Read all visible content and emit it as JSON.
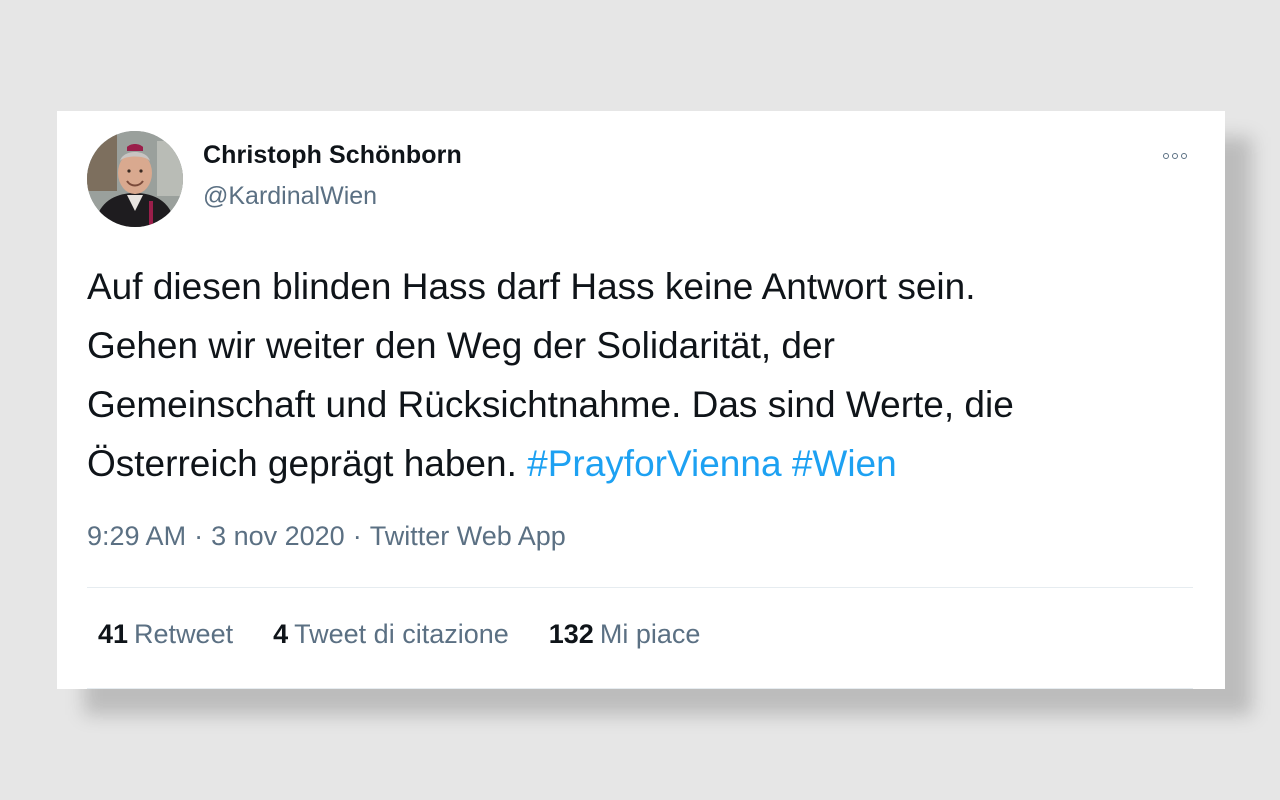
{
  "tweet": {
    "author_name": "Christoph Schönborn",
    "author_handle": "@KardinalWien",
    "text_lines": [
      "Auf diesen blinden Hass darf Hass keine Antwort sein.",
      "Gehen wir weiter den Weg der Solidarität, der",
      "Gemeinschaft und Rücksichtnahme. Das sind Werte, die",
      "Österreich geprägt haben. "
    ],
    "hashtags": [
      "#PrayforVienna",
      "#Wien"
    ],
    "time": "9:29 AM",
    "date": "3 nov 2020",
    "source": "Twitter Web App",
    "separator": "·"
  },
  "stats": {
    "retweets": {
      "count": "41",
      "label": "Retweet"
    },
    "quotes": {
      "count": "4",
      "label": "Tweet di citazione"
    },
    "likes": {
      "count": "132",
      "label": "Mi piace"
    }
  },
  "icons": {
    "more": "more-options-icon",
    "avatar": "avatar"
  },
  "colors": {
    "hashtag": "#1da1f2",
    "secondary_text": "#5b7083",
    "primary_text": "#0f1419",
    "background": "#e6e6e6"
  }
}
